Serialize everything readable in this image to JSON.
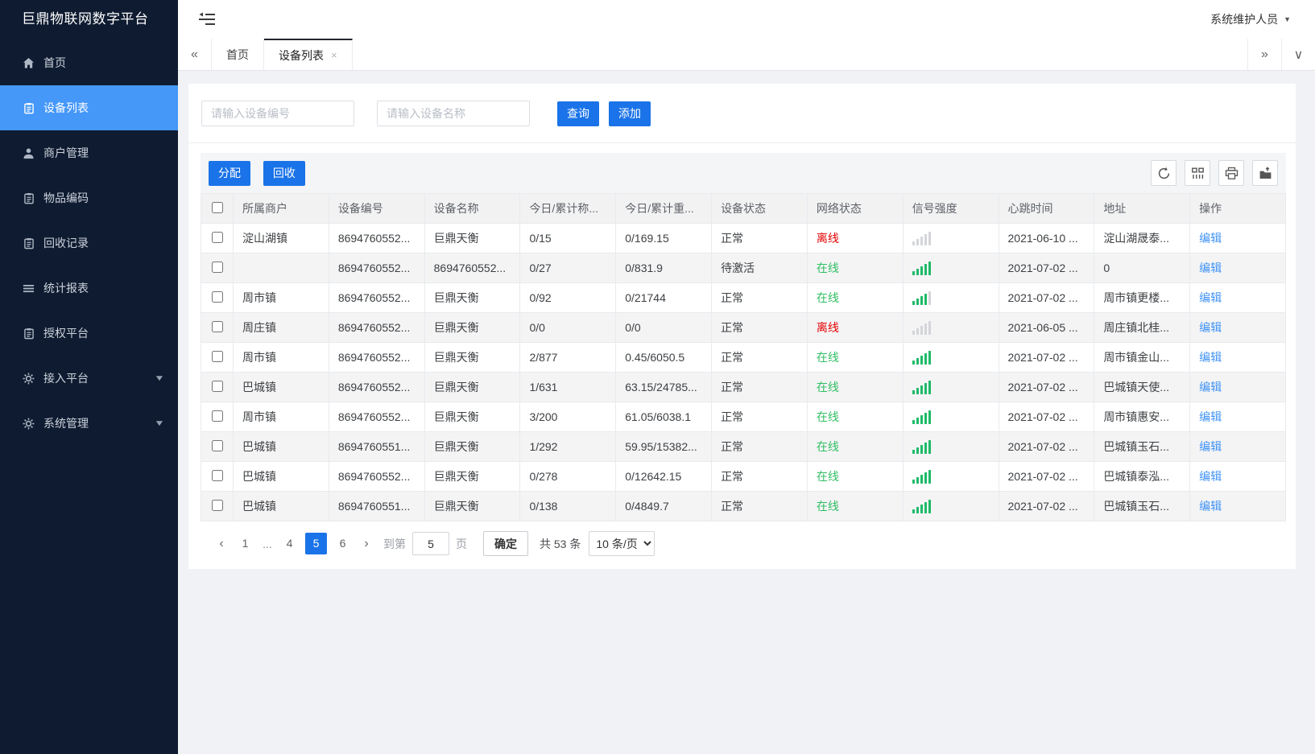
{
  "app": {
    "title": "巨鼎物联网数字平台",
    "user": "系统维护人员"
  },
  "colors": {
    "sidebar_bg": "#0e1b30",
    "accent": "#1a73e8",
    "active_blue": "#4597f8",
    "link_blue": "#4093f5",
    "green": "#2fbe62",
    "signal_green": "#1fba68",
    "red": "#e60000"
  },
  "sidebar": {
    "items": [
      {
        "label": "首页",
        "icon": "home-icon",
        "active": false,
        "caret": false
      },
      {
        "label": "设备列表",
        "icon": "clipboard-icon",
        "active": true,
        "caret": false
      },
      {
        "label": "商户管理",
        "icon": "user-icon",
        "active": false,
        "caret": false
      },
      {
        "label": "物品编码",
        "icon": "clipboard-icon",
        "active": false,
        "caret": false
      },
      {
        "label": "回收记录",
        "icon": "clipboard-icon",
        "active": false,
        "caret": false
      },
      {
        "label": "统计报表",
        "icon": "lines-icon",
        "active": false,
        "caret": false
      },
      {
        "label": "授权平台",
        "icon": "clipboard-icon",
        "active": false,
        "caret": false
      },
      {
        "label": "接入平台",
        "icon": "gear-icon",
        "active": false,
        "caret": true
      },
      {
        "label": "系统管理",
        "icon": "gear-icon",
        "active": false,
        "caret": true
      }
    ],
    "caret_glyph": "▼"
  },
  "topbar": {
    "collapse_icon": "menu-toggle-icon",
    "user_caret": "▼"
  },
  "tabs": {
    "collapse_left": "«",
    "expand_right": "»",
    "more": "∨",
    "close_glyph": "×",
    "items": [
      {
        "label": "首页",
        "active": false,
        "closable": false
      },
      {
        "label": "设备列表",
        "active": true,
        "closable": true
      }
    ]
  },
  "search": {
    "device_no_placeholder": "请输入设备编号",
    "device_name_placeholder": "请输入设备名称",
    "query_label": "查询",
    "add_label": "添加"
  },
  "toolbar": {
    "assign_label": "分配",
    "recycle_label": "回收",
    "icons": [
      "refresh-icon",
      "columns-icon",
      "print-icon",
      "export-icon"
    ]
  },
  "table": {
    "columns": [
      "所属商户",
      "设备编号",
      "设备名称",
      "今日/累计称...",
      "今日/累计重...",
      "设备状态",
      "网络状态",
      "信号强度",
      "心跳时间",
      "地址",
      "操作"
    ],
    "edit_label": "编辑",
    "rows": [
      {
        "merchant": "淀山湖镇",
        "device_no": "8694760552...",
        "device_name": "巨鼎天衡",
        "today_count": "0/15",
        "today_weight": "0/169.15",
        "device_status": "正常",
        "network_status": "离线",
        "online": false,
        "signal": 0,
        "heartbeat": "2021-06-10 ...",
        "address": "淀山湖晟泰..."
      },
      {
        "merchant": "",
        "device_no": "8694760552...",
        "device_name": "8694760552...",
        "today_count": "0/27",
        "today_weight": "0/831.9",
        "device_status": "待激活",
        "network_status": "在线",
        "online": true,
        "signal": 5,
        "heartbeat": "2021-07-02 ...",
        "address": "0"
      },
      {
        "merchant": "周市镇",
        "device_no": "8694760552...",
        "device_name": "巨鼎天衡",
        "today_count": "0/92",
        "today_weight": "0/21744",
        "device_status": "正常",
        "network_status": "在线",
        "online": true,
        "signal": 4,
        "heartbeat": "2021-07-02 ...",
        "address": "周市镇更楼..."
      },
      {
        "merchant": "周庄镇",
        "device_no": "8694760552...",
        "device_name": "巨鼎天衡",
        "today_count": "0/0",
        "today_weight": "0/0",
        "device_status": "正常",
        "network_status": "离线",
        "online": false,
        "signal": 0,
        "heartbeat": "2021-06-05 ...",
        "address": "周庄镇北桂..."
      },
      {
        "merchant": "周市镇",
        "device_no": "8694760552...",
        "device_name": "巨鼎天衡",
        "today_count": "2/877",
        "today_weight": "0.45/6050.5",
        "device_status": "正常",
        "network_status": "在线",
        "online": true,
        "signal": 5,
        "heartbeat": "2021-07-02 ...",
        "address": "周市镇金山..."
      },
      {
        "merchant": "巴城镇",
        "device_no": "8694760552...",
        "device_name": "巨鼎天衡",
        "today_count": "1/631",
        "today_weight": "63.15/24785...",
        "device_status": "正常",
        "network_status": "在线",
        "online": true,
        "signal": 5,
        "heartbeat": "2021-07-02 ...",
        "address": "巴城镇天使..."
      },
      {
        "merchant": "周市镇",
        "device_no": "8694760552...",
        "device_name": "巨鼎天衡",
        "today_count": "3/200",
        "today_weight": "61.05/6038.1",
        "device_status": "正常",
        "network_status": "在线",
        "online": true,
        "signal": 5,
        "heartbeat": "2021-07-02 ...",
        "address": "周市镇惠安..."
      },
      {
        "merchant": "巴城镇",
        "device_no": "8694760551...",
        "device_name": "巨鼎天衡",
        "today_count": "1/292",
        "today_weight": "59.95/15382...",
        "device_status": "正常",
        "network_status": "在线",
        "online": true,
        "signal": 5,
        "heartbeat": "2021-07-02 ...",
        "address": "巴城镇玉石..."
      },
      {
        "merchant": "巴城镇",
        "device_no": "8694760552...",
        "device_name": "巨鼎天衡",
        "today_count": "0/278",
        "today_weight": "0/12642.15",
        "device_status": "正常",
        "network_status": "在线",
        "online": true,
        "signal": 5,
        "heartbeat": "2021-07-02 ...",
        "address": "巴城镇泰泓..."
      },
      {
        "merchant": "巴城镇",
        "device_no": "8694760551...",
        "device_name": "巨鼎天衡",
        "today_count": "0/138",
        "today_weight": "0/4849.7",
        "device_status": "正常",
        "network_status": "在线",
        "online": true,
        "signal": 5,
        "heartbeat": "2021-07-02 ...",
        "address": "巴城镇玉石..."
      }
    ]
  },
  "pagination": {
    "prev": "‹",
    "next": "›",
    "pages": [
      {
        "label": "1",
        "active": false,
        "ellipsis": false
      },
      {
        "label": "...",
        "active": false,
        "ellipsis": true
      },
      {
        "label": "4",
        "active": false,
        "ellipsis": false
      },
      {
        "label": "5",
        "active": true,
        "ellipsis": false
      },
      {
        "label": "6",
        "active": false,
        "ellipsis": false
      }
    ],
    "goto_prefix": "到第",
    "goto_value": "5",
    "goto_suffix": "页",
    "confirm_label": "确定",
    "total_label": "共 53 条",
    "page_size_label": "10 条/页"
  }
}
